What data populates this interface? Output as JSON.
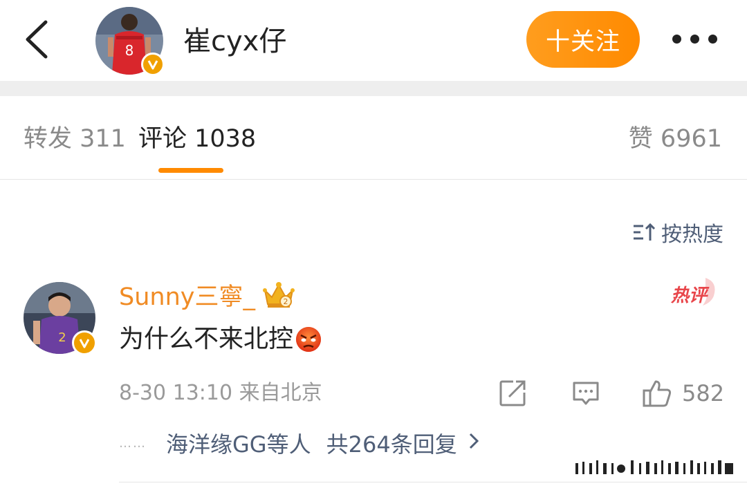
{
  "header": {
    "username": "崔cyx仔",
    "follow_label": "十关注"
  },
  "tabs": {
    "repost_label": "转发 311",
    "comment_label": "评论 1038",
    "likes_label": "赞 6961"
  },
  "sort": {
    "label": "按热度"
  },
  "comment": {
    "author": "Sunny三寧_",
    "text": "为什么不来北控",
    "hot_tag": "热评",
    "time_location": "8-30 13:10 来自北京",
    "like_count": "582",
    "replies_dots": "……",
    "replies_users": "海洋缘GG等人",
    "replies_count": "共264条回复"
  },
  "colors": {
    "accent": "#ff8a00",
    "username": "#f08b24",
    "link": "#4f5e77",
    "meta": "#9a9a9a",
    "hot": "#e8454a",
    "verified": "#f0a000"
  },
  "icons": [
    "back-arrow-icon",
    "verified-icon",
    "more-icon",
    "sort-icon",
    "crown-badge-icon",
    "angry-emoji-icon",
    "share-icon",
    "reply-icon",
    "like-icon",
    "chevron-right-icon"
  ]
}
